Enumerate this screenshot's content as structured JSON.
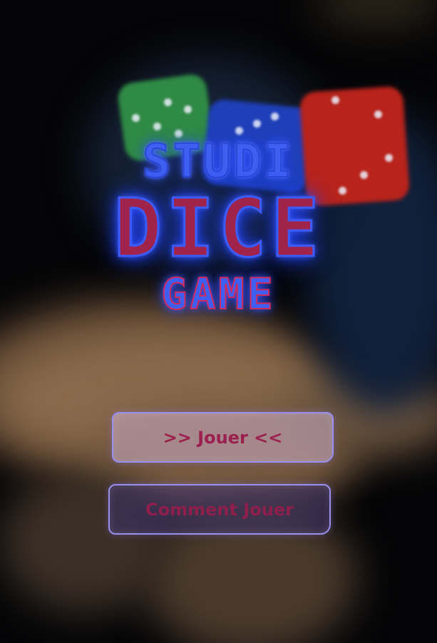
{
  "title": {
    "line1": "STUDI",
    "line2": "DICE",
    "line3": "GAME"
  },
  "menu": {
    "play_label": ">> Jouer <<",
    "howto_label": "Comment Jouer"
  },
  "colors": {
    "title_blue": "#3f5ff2",
    "title_red": "#a0234b",
    "button_border": "#9a8ff0",
    "button_text": "#9b2050"
  },
  "background": {
    "dice": [
      "green",
      "blue",
      "red"
    ]
  }
}
